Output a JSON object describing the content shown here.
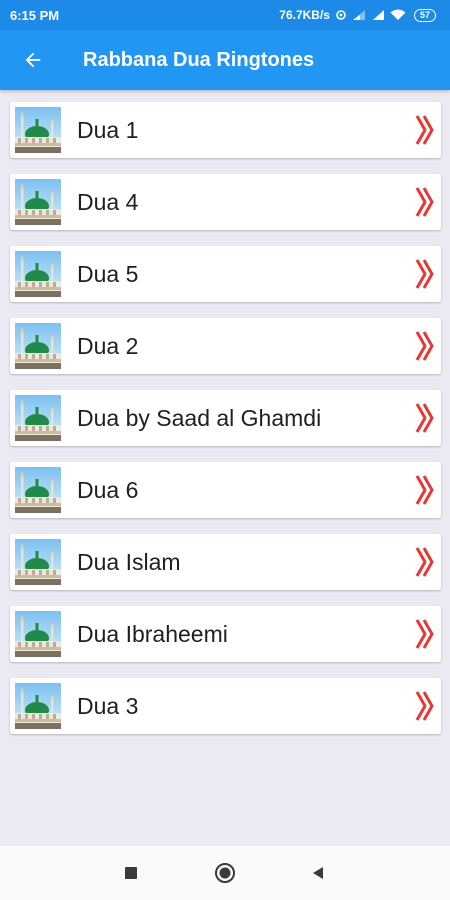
{
  "status": {
    "time": "6:15 PM",
    "speed": "76.7KB/s",
    "battery": "57"
  },
  "appbar": {
    "title": "Rabbana Dua Ringtones",
    "back_icon": "arrow-left-icon"
  },
  "items": [
    {
      "label": "Dua 1"
    },
    {
      "label": "Dua 4"
    },
    {
      "label": "Dua 5"
    },
    {
      "label": "Dua 2"
    },
    {
      "label": "Dua by Saad al Ghamdi"
    },
    {
      "label": "Dua 6"
    },
    {
      "label": "Dua Islam"
    },
    {
      "label": "Dua Ibraheemi"
    },
    {
      "label": "Dua 3"
    }
  ],
  "colors": {
    "status_bar": "#1d8ae8",
    "app_bar": "#2196f3",
    "chevron": "#e53935",
    "background": "#ebe9f1"
  }
}
